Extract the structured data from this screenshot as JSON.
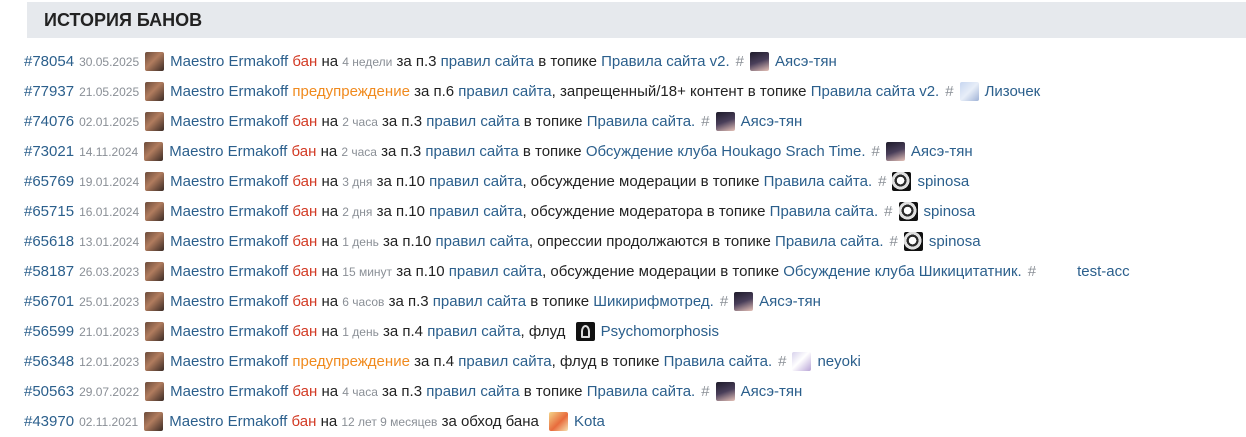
{
  "section_title": "ИСТОРИЯ БАНОВ",
  "bans": [
    {
      "id": "#78054",
      "date": "30.05.2025",
      "moderator": "Maestro Ermakoff",
      "type": "бан",
      "type_class": "ban",
      "on": "на",
      "duration": "4 недели",
      "rule_prefix": "за п.3",
      "rule_link": "правил сайта",
      "extra": "",
      "topic_prefix": "в топике",
      "topic": "Правила сайта v2.",
      "hash": "#",
      "user": "Аясэ-тян",
      "user_avatar": "ayase"
    },
    {
      "id": "#77937",
      "date": "21.05.2025",
      "moderator": "Maestro Ermakoff",
      "type": "предупреждение",
      "type_class": "warn",
      "on": "",
      "duration": "",
      "rule_prefix": "за п.6",
      "rule_link": "правил сайта",
      "extra": ", запрещенный/18+ контент",
      "topic_prefix": "в топике",
      "topic": "Правила сайта v2.",
      "hash": "#",
      "user": "Лизочек",
      "user_avatar": "lizochek"
    },
    {
      "id": "#74076",
      "date": "02.01.2025",
      "moderator": "Maestro Ermakoff",
      "type": "бан",
      "type_class": "ban",
      "on": "на",
      "duration": "2 часа",
      "rule_prefix": "за п.3",
      "rule_link": "правил сайта",
      "extra": "",
      "topic_prefix": "в топике",
      "topic": "Правила сайта.",
      "hash": "#",
      "user": "Аясэ-тян",
      "user_avatar": "ayase"
    },
    {
      "id": "#73021",
      "date": "14.11.2024",
      "moderator": "Maestro Ermakoff",
      "type": "бан",
      "type_class": "ban",
      "on": "на",
      "duration": "2 часа",
      "rule_prefix": "за п.3",
      "rule_link": "правил сайта",
      "extra": "",
      "topic_prefix": "в топике",
      "topic": "Обсуждение клуба Houkago Srach Time.",
      "hash": "#",
      "user": "Аясэ-тян",
      "user_avatar": "ayase"
    },
    {
      "id": "#65769",
      "date": "19.01.2024",
      "moderator": "Maestro Ermakoff",
      "type": "бан",
      "type_class": "ban",
      "on": "на",
      "duration": "3 дня",
      "rule_prefix": "за п.10",
      "rule_link": "правил сайта",
      "extra": ", обсуждение модерации",
      "topic_prefix": "в топике",
      "topic": "Правила сайта.",
      "hash": "#",
      "user": "spinosa",
      "user_avatar": "spinosa"
    },
    {
      "id": "#65715",
      "date": "16.01.2024",
      "moderator": "Maestro Ermakoff",
      "type": "бан",
      "type_class": "ban",
      "on": "на",
      "duration": "2 дня",
      "rule_prefix": "за п.10",
      "rule_link": "правил сайта",
      "extra": ", обсуждение модератора",
      "topic_prefix": "в топике",
      "topic": "Правила сайта.",
      "hash": "#",
      "user": "spinosa",
      "user_avatar": "spinosa"
    },
    {
      "id": "#65618",
      "date": "13.01.2024",
      "moderator": "Maestro Ermakoff",
      "type": "бан",
      "type_class": "ban",
      "on": "на",
      "duration": "1 день",
      "rule_prefix": "за п.10",
      "rule_link": "правил сайта",
      "extra": ", опрессии продолжаются",
      "topic_prefix": "в топике",
      "topic": "Правила сайта.",
      "hash": "#",
      "user": "spinosa",
      "user_avatar": "spinosa"
    },
    {
      "id": "#58187",
      "date": "26.03.2023",
      "moderator": "Maestro Ermakoff",
      "type": "бан",
      "type_class": "ban",
      "on": "на",
      "duration": "15 минут",
      "rule_prefix": "за п.10",
      "rule_link": "правил сайта",
      "extra": ", обсуждение модерации",
      "topic_prefix": "в топике",
      "topic": "Обсуждение клуба Шикицитатник.",
      "hash": "#",
      "user": "test-acc",
      "user_avatar": "testacc"
    },
    {
      "id": "#56701",
      "date": "25.01.2023",
      "moderator": "Maestro Ermakoff",
      "type": "бан",
      "type_class": "ban",
      "on": "на",
      "duration": "6 часов",
      "rule_prefix": "за п.3",
      "rule_link": "правил сайта",
      "extra": "",
      "topic_prefix": "в топике",
      "topic": "Шикирифмотред.",
      "hash": "#",
      "user": "Аясэ-тян",
      "user_avatar": "ayase"
    },
    {
      "id": "#56599",
      "date": "21.01.2023",
      "moderator": "Maestro Ermakoff",
      "type": "бан",
      "type_class": "ban",
      "on": "на",
      "duration": "1 день",
      "rule_prefix": "за п.4",
      "rule_link": "правил сайта",
      "extra": ", флуд",
      "topic_prefix": "",
      "topic": "",
      "hash": "",
      "user": "Psychomorphosis",
      "user_avatar": "psycho"
    },
    {
      "id": "#56348",
      "date": "12.01.2023",
      "moderator": "Maestro Ermakoff",
      "type": "предупреждение",
      "type_class": "warn",
      "on": "",
      "duration": "",
      "rule_prefix": "за п.4",
      "rule_link": "правил сайта",
      "extra": ", флуд",
      "topic_prefix": "в топике",
      "topic": "Правила сайта.",
      "hash": "#",
      "user": "neyoki",
      "user_avatar": "neyoki"
    },
    {
      "id": "#50563",
      "date": "29.07.2022",
      "moderator": "Maestro Ermakoff",
      "type": "бан",
      "type_class": "ban",
      "on": "на",
      "duration": "4 часа",
      "rule_prefix": "за п.3",
      "rule_link": "правил сайта",
      "extra": "",
      "topic_prefix": "в топике",
      "topic": "Правила сайта.",
      "hash": "#",
      "user": "Аясэ-тян",
      "user_avatar": "ayase"
    },
    {
      "id": "#43970",
      "date": "02.11.2021",
      "moderator": "Maestro Ermakoff",
      "type": "бан",
      "type_class": "ban",
      "on": "на",
      "duration": "12 лет 9 месяцев",
      "rule_prefix": "за обход бана",
      "rule_link": "",
      "extra": "",
      "topic_prefix": "",
      "topic": "",
      "hash": "",
      "user": "Kota",
      "user_avatar": "kota"
    }
  ]
}
